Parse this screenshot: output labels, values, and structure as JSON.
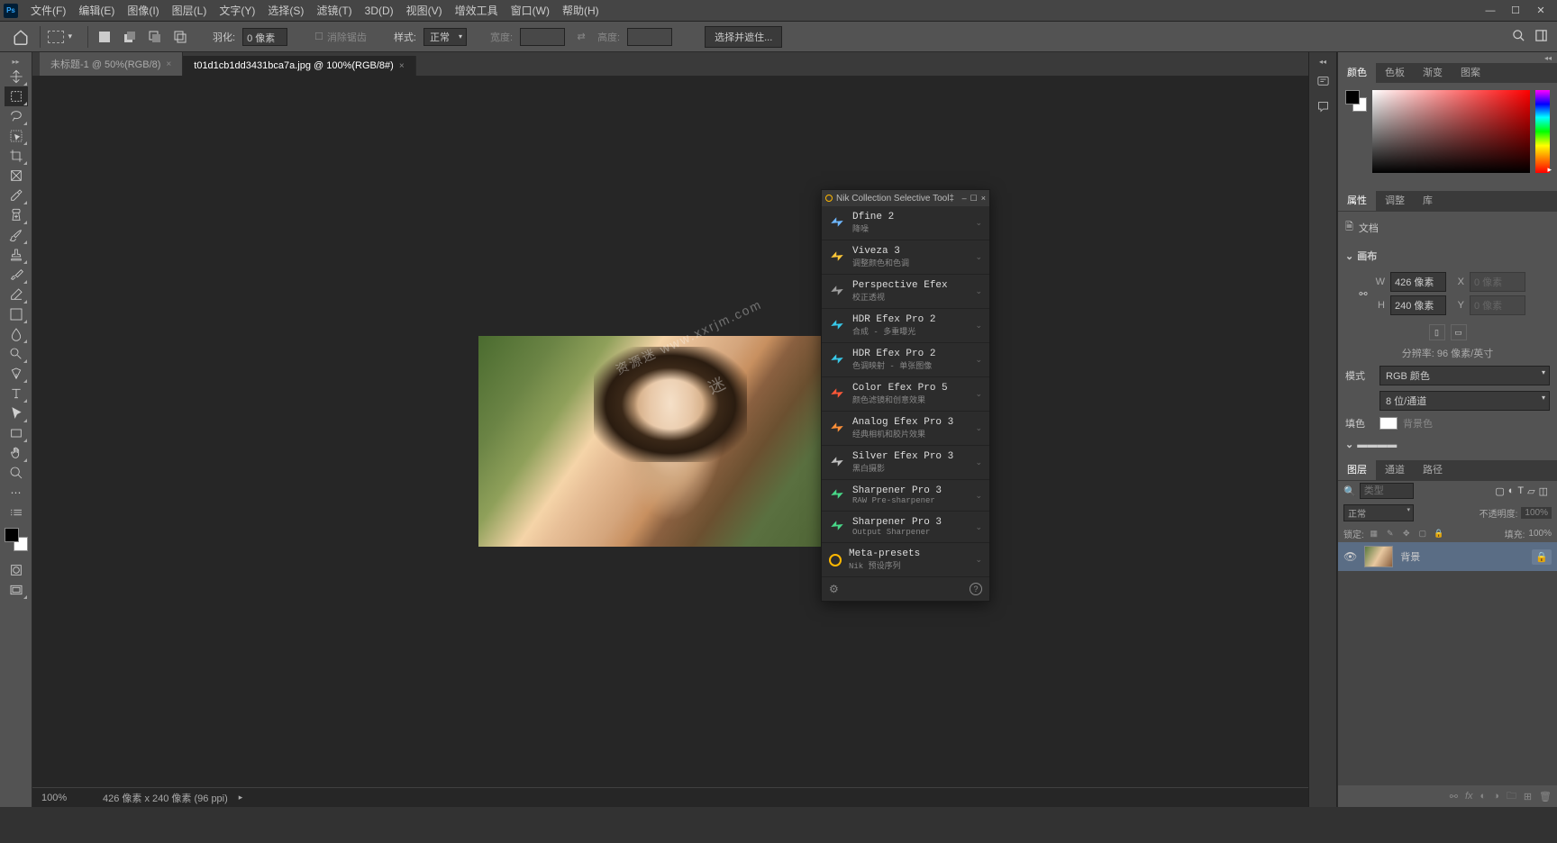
{
  "menu": {
    "items": [
      "文件(F)",
      "编辑(E)",
      "图像(I)",
      "图层(L)",
      "文字(Y)",
      "选择(S)",
      "滤镜(T)",
      "3D(D)",
      "视图(V)",
      "增效工具",
      "窗口(W)",
      "帮助(H)"
    ]
  },
  "optbar": {
    "feather_label": "羽化:",
    "feather_val": "0 像素",
    "antialias": "消除锯齿",
    "style_label": "样式:",
    "style_val": "正常",
    "width_label": "宽度:",
    "height_label": "高度:",
    "mask_btn": "选择并遮住..."
  },
  "tabs": [
    {
      "label": "未标题-1 @ 50%(RGB/8)"
    },
    {
      "label": "t01d1cb1dd3431bca7a.jpg @ 100%(RGB/8#)"
    }
  ],
  "status": {
    "zoom": "100%",
    "info": "426 像素 x 240 像素 (96 ppi)"
  },
  "color_tabs": [
    "颜色",
    "色板",
    "渐变",
    "图案"
  ],
  "props_tabs": [
    "属性",
    "调整",
    "库"
  ],
  "props": {
    "doc": "文档",
    "canvas": "画布",
    "w": "426 像素",
    "h": "240 像素",
    "x": "0 像素",
    "y": "0 像素",
    "res": "分辨率: 96 像素/英寸",
    "mode_label": "模式",
    "mode": "RGB 颜色",
    "depth": "8 位/通道",
    "fill_label": "填色",
    "fill_val": "背景色"
  },
  "layers_tabs": [
    "图层",
    "通道",
    "路径"
  ],
  "layers": {
    "kind": "类型",
    "blend": "正常",
    "opacity_label": "不透明度:",
    "opacity": "100%",
    "lock_label": "锁定:",
    "fill_label": "填充:",
    "fill": "100%",
    "layer_name": "背景"
  },
  "nik": {
    "title": "Nik Collection Selective Tool‡",
    "items": [
      {
        "name": "Dfine 2",
        "desc": "降噪",
        "color": "#6fb7ff"
      },
      {
        "name": "Viveza 3",
        "desc": "调整颜色和色调",
        "color": "#ffc838"
      },
      {
        "name": "Perspective Efex",
        "desc": "校正透视",
        "color": "#a0a0a0"
      },
      {
        "name": "HDR Efex Pro 2",
        "desc": "合成 - 多重曝光",
        "color": "#38c8e8"
      },
      {
        "name": "HDR Efex Pro 2",
        "desc": "色调映射 - 单张图像",
        "color": "#38c8e8"
      },
      {
        "name": "Color Efex Pro 5",
        "desc": "颜色滤镜和创意效果",
        "color": "#ff5838"
      },
      {
        "name": "Analog Efex Pro 3",
        "desc": "经典相机和胶片效果",
        "color": "#ff9038"
      },
      {
        "name": "Silver Efex Pro 3",
        "desc": "黑白摄影",
        "color": "#c0c0c0"
      },
      {
        "name": "Sharpener Pro 3",
        "desc": "RAW Pre-sharpener",
        "color": "#48d888"
      },
      {
        "name": "Sharpener Pro 3",
        "desc": "Output Sharpener",
        "color": "#48d888"
      },
      {
        "name": "Meta-presets",
        "desc": "Nik 预设序列",
        "color": "#ffb800"
      }
    ]
  },
  "watermark": "资源迷 www.xxrjm.com"
}
